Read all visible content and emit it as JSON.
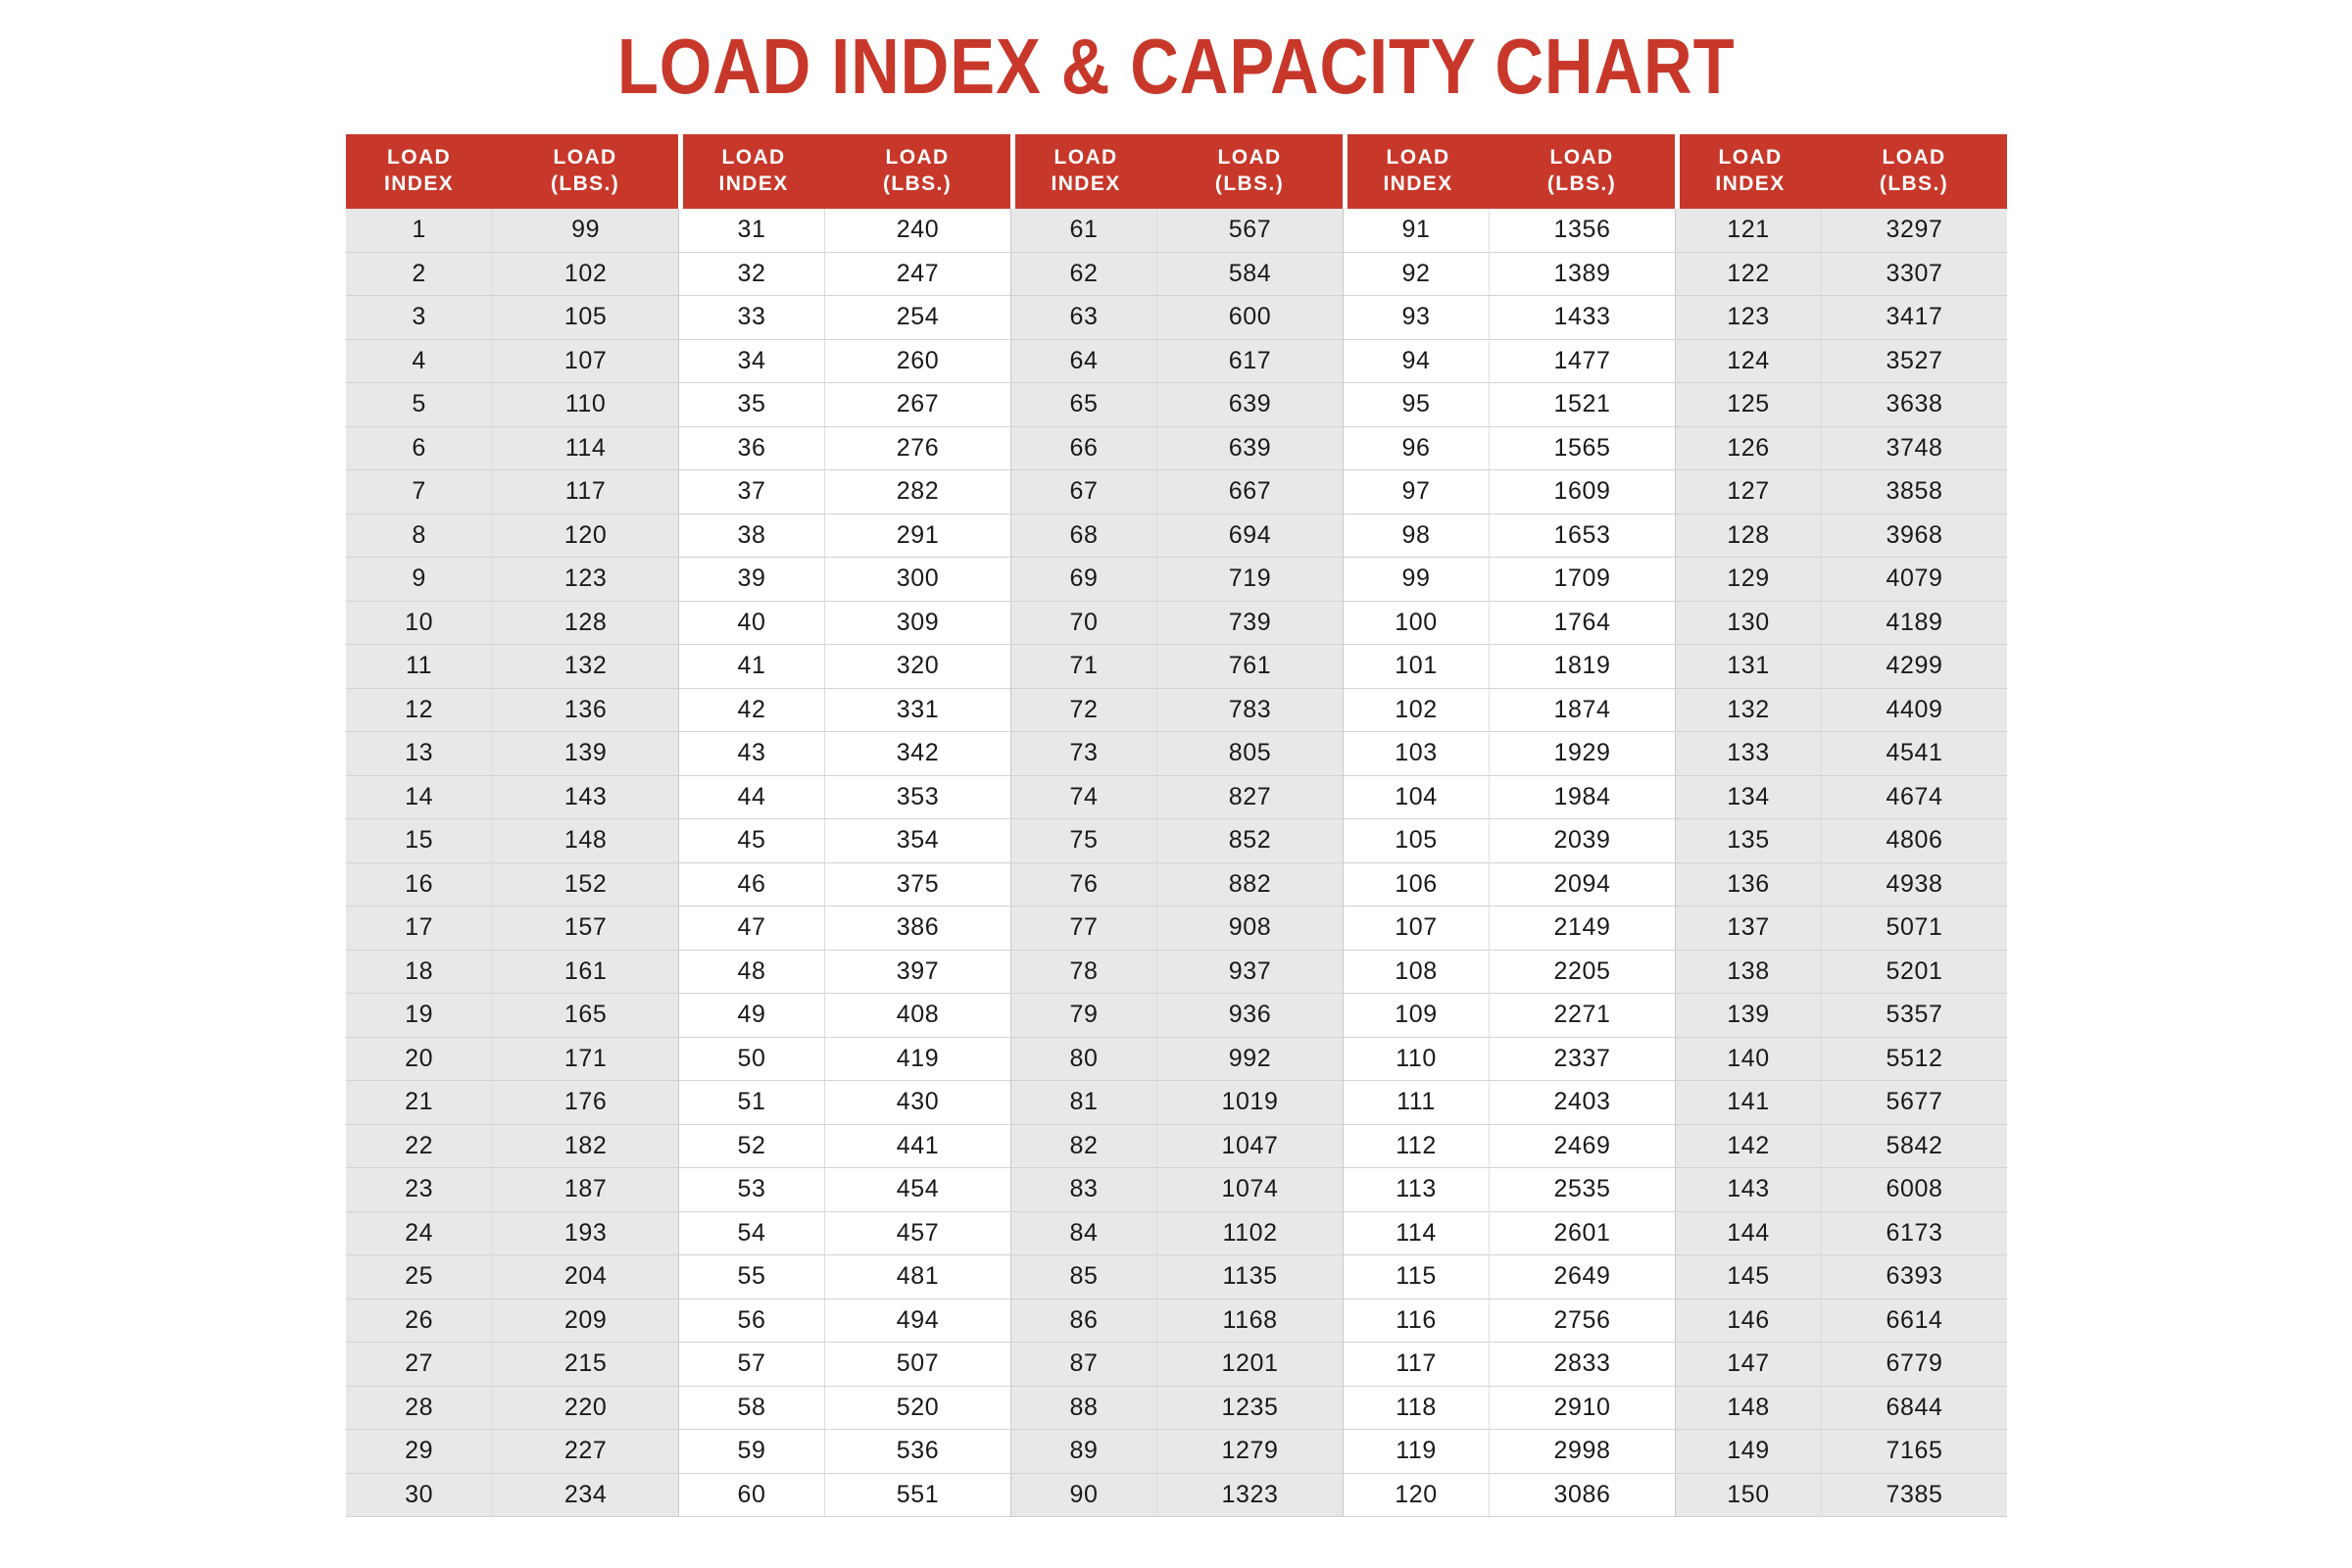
{
  "title": "LOAD INDEX & CAPACITY CHART",
  "colors": {
    "accent_red": "#C7382B",
    "header_text": "#FFFFFF",
    "shaded_cell": "#E8E8E8",
    "plain_cell": "#FFFFFF",
    "cell_text": "#1A1A1A"
  },
  "table": {
    "headers": [
      "LOAD\nINDEX",
      "LOAD\n(LBS.)",
      "LOAD\nINDEX",
      "LOAD\n(LBS.)",
      "LOAD\nINDEX",
      "LOAD\n(LBS.)",
      "LOAD\nINDEX",
      "LOAD\n(LBS.)",
      "LOAD\nINDEX",
      "LOAD\n(LBS.)"
    ],
    "rows": [
      [
        "1",
        "99",
        "31",
        "240",
        "61",
        "567",
        "91",
        "1356",
        "121",
        "3297"
      ],
      [
        "2",
        "102",
        "32",
        "247",
        "62",
        "584",
        "92",
        "1389",
        "122",
        "3307"
      ],
      [
        "3",
        "105",
        "33",
        "254",
        "63",
        "600",
        "93",
        "1433",
        "123",
        "3417"
      ],
      [
        "4",
        "107",
        "34",
        "260",
        "64",
        "617",
        "94",
        "1477",
        "124",
        "3527"
      ],
      [
        "5",
        "110",
        "35",
        "267",
        "65",
        "639",
        "95",
        "1521",
        "125",
        "3638"
      ],
      [
        "6",
        "114",
        "36",
        "276",
        "66",
        "639",
        "96",
        "1565",
        "126",
        "3748"
      ],
      [
        "7",
        "117",
        "37",
        "282",
        "67",
        "667",
        "97",
        "1609",
        "127",
        "3858"
      ],
      [
        "8",
        "120",
        "38",
        "291",
        "68",
        "694",
        "98",
        "1653",
        "128",
        "3968"
      ],
      [
        "9",
        "123",
        "39",
        "300",
        "69",
        "719",
        "99",
        "1709",
        "129",
        "4079"
      ],
      [
        "10",
        "128",
        "40",
        "309",
        "70",
        "739",
        "100",
        "1764",
        "130",
        "4189"
      ],
      [
        "11",
        "132",
        "41",
        "320",
        "71",
        "761",
        "101",
        "1819",
        "131",
        "4299"
      ],
      [
        "12",
        "136",
        "42",
        "331",
        "72",
        "783",
        "102",
        "1874",
        "132",
        "4409"
      ],
      [
        "13",
        "139",
        "43",
        "342",
        "73",
        "805",
        "103",
        "1929",
        "133",
        "4541"
      ],
      [
        "14",
        "143",
        "44",
        "353",
        "74",
        "827",
        "104",
        "1984",
        "134",
        "4674"
      ],
      [
        "15",
        "148",
        "45",
        "354",
        "75",
        "852",
        "105",
        "2039",
        "135",
        "4806"
      ],
      [
        "16",
        "152",
        "46",
        "375",
        "76",
        "882",
        "106",
        "2094",
        "136",
        "4938"
      ],
      [
        "17",
        "157",
        "47",
        "386",
        "77",
        "908",
        "107",
        "2149",
        "137",
        "5071"
      ],
      [
        "18",
        "161",
        "48",
        "397",
        "78",
        "937",
        "108",
        "2205",
        "138",
        "5201"
      ],
      [
        "19",
        "165",
        "49",
        "408",
        "79",
        "936",
        "109",
        "2271",
        "139",
        "5357"
      ],
      [
        "20",
        "171",
        "50",
        "419",
        "80",
        "992",
        "110",
        "2337",
        "140",
        "5512"
      ],
      [
        "21",
        "176",
        "51",
        "430",
        "81",
        "1019",
        "111",
        "2403",
        "141",
        "5677"
      ],
      [
        "22",
        "182",
        "52",
        "441",
        "82",
        "1047",
        "112",
        "2469",
        "142",
        "5842"
      ],
      [
        "23",
        "187",
        "53",
        "454",
        "83",
        "1074",
        "113",
        "2535",
        "143",
        "6008"
      ],
      [
        "24",
        "193",
        "54",
        "457",
        "84",
        "1102",
        "114",
        "2601",
        "144",
        "6173"
      ],
      [
        "25",
        "204",
        "55",
        "481",
        "85",
        "1135",
        "115",
        "2649",
        "145",
        "6393"
      ],
      [
        "26",
        "209",
        "56",
        "494",
        "86",
        "1168",
        "116",
        "2756",
        "146",
        "6614"
      ],
      [
        "27",
        "215",
        "57",
        "507",
        "87",
        "1201",
        "117",
        "2833",
        "147",
        "6779"
      ],
      [
        "28",
        "220",
        "58",
        "520",
        "88",
        "1235",
        "118",
        "2910",
        "148",
        "6844"
      ],
      [
        "29",
        "227",
        "59",
        "536",
        "89",
        "1279",
        "119",
        "2998",
        "149",
        "7165"
      ],
      [
        "30",
        "234",
        "60",
        "551",
        "90",
        "1323",
        "120",
        "3086",
        "150",
        "7385"
      ]
    ]
  },
  "chart_data": {
    "type": "table",
    "title": "LOAD INDEX & CAPACITY CHART",
    "xlabel": "Load Index",
    "ylabel": "Load (lbs.)",
    "columns": [
      "LOAD INDEX",
      "LOAD (LBS.)"
    ],
    "load_index": [
      1,
      2,
      3,
      4,
      5,
      6,
      7,
      8,
      9,
      10,
      11,
      12,
      13,
      14,
      15,
      16,
      17,
      18,
      19,
      20,
      21,
      22,
      23,
      24,
      25,
      26,
      27,
      28,
      29,
      30,
      31,
      32,
      33,
      34,
      35,
      36,
      37,
      38,
      39,
      40,
      41,
      42,
      43,
      44,
      45,
      46,
      47,
      48,
      49,
      50,
      51,
      52,
      53,
      54,
      55,
      56,
      57,
      58,
      59,
      60,
      61,
      62,
      63,
      64,
      65,
      66,
      67,
      68,
      69,
      70,
      71,
      72,
      73,
      74,
      75,
      76,
      77,
      78,
      79,
      80,
      81,
      82,
      83,
      84,
      85,
      86,
      87,
      88,
      89,
      90,
      91,
      92,
      93,
      94,
      95,
      96,
      97,
      98,
      99,
      100,
      101,
      102,
      103,
      104,
      105,
      106,
      107,
      108,
      109,
      110,
      111,
      112,
      113,
      114,
      115,
      116,
      117,
      118,
      119,
      120,
      121,
      122,
      123,
      124,
      125,
      126,
      127,
      128,
      129,
      130,
      131,
      132,
      133,
      134,
      135,
      136,
      137,
      138,
      139,
      140,
      141,
      142,
      143,
      144,
      145,
      146,
      147,
      148,
      149,
      150
    ],
    "load_lbs": [
      99,
      102,
      105,
      107,
      110,
      114,
      117,
      120,
      123,
      128,
      132,
      136,
      139,
      143,
      148,
      152,
      157,
      161,
      165,
      171,
      176,
      182,
      187,
      193,
      204,
      209,
      215,
      220,
      227,
      234,
      240,
      247,
      254,
      260,
      267,
      276,
      282,
      291,
      300,
      309,
      320,
      331,
      342,
      353,
      354,
      375,
      386,
      397,
      408,
      419,
      430,
      441,
      454,
      457,
      481,
      494,
      507,
      520,
      536,
      551,
      567,
      584,
      600,
      617,
      639,
      639,
      667,
      694,
      719,
      739,
      761,
      783,
      805,
      827,
      852,
      882,
      908,
      937,
      936,
      992,
      1019,
      1047,
      1074,
      1102,
      1135,
      1168,
      1201,
      1235,
      1279,
      1323,
      1356,
      1389,
      1433,
      1477,
      1521,
      1565,
      1609,
      1653,
      1709,
      1764,
      1819,
      1874,
      1929,
      1984,
      2039,
      2094,
      2149,
      2205,
      2271,
      2337,
      2403,
      2469,
      2535,
      2601,
      2649,
      2756,
      2833,
      2910,
      2998,
      3086,
      3297,
      3307,
      3417,
      3527,
      3638,
      3748,
      3858,
      3968,
      4079,
      4189,
      4299,
      4409,
      4541,
      4674,
      4806,
      4938,
      5071,
      5201,
      5357,
      5512,
      5677,
      5842,
      6008,
      6173,
      6393,
      6614,
      6779,
      6844,
      7165,
      7385
    ]
  }
}
